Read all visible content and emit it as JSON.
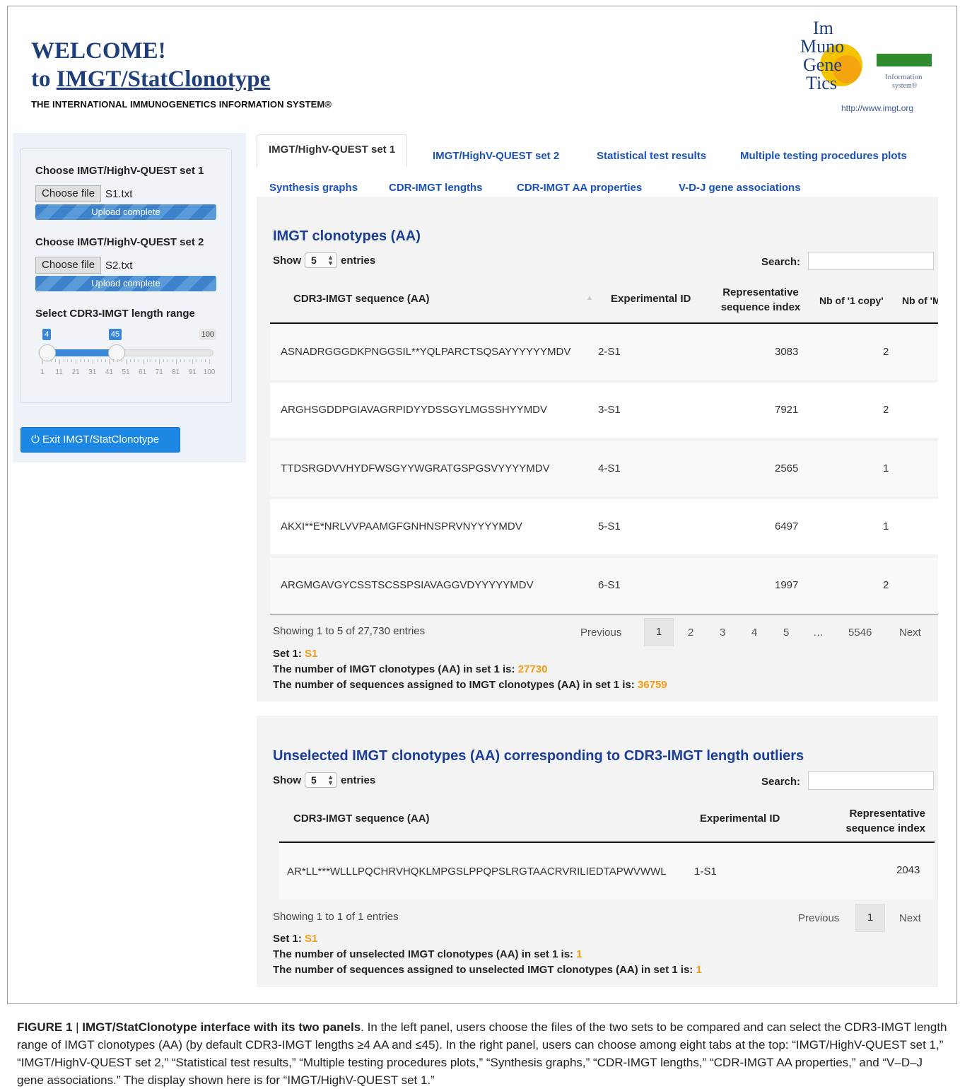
{
  "header": {
    "welcome_line1": "WELCOME!",
    "welcome_to": "to ",
    "welcome_app": "IMGT/StatClonotype",
    "subtitle": "THE INTERNATIONAL IMMUNOGENETICS INFORMATION SYSTEM®",
    "logo": {
      "letters": [
        "Im",
        "Muno",
        "Gene",
        "Tics"
      ],
      "tagline1": "Information",
      "tagline2": "system®",
      "url": "http://www.imgt.org"
    }
  },
  "sidebar": {
    "set1_label": "Choose IMGT/HighV-QUEST set 1",
    "set1_button": "Choose file",
    "set1_file": "S1.txt",
    "set1_status": "Upload complete",
    "set2_label": "Choose IMGT/HighV-QUEST set 2",
    "set2_button": "Choose file",
    "set2_file": "S2.txt",
    "set2_status": "Upload complete",
    "range_label": "Select CDR3-IMGT length range",
    "range_min": "4",
    "range_max": "45",
    "range_limit": "100",
    "range_min_value": 4,
    "range_max_value": 45,
    "range_scale_max": 100,
    "tick_labels": [
      "1",
      "11",
      "21",
      "31",
      "41",
      "51",
      "61",
      "71",
      "81",
      "91",
      "100"
    ],
    "exit_label": "Exit IMGT/StatClonotype"
  },
  "tabs": [
    "IMGT/HighV-QUEST set 1",
    "IMGT/HighV-QUEST set 2",
    "Statistical test results",
    "Multiple testing procedures plots",
    "Synthesis graphs",
    "CDR-IMGT lengths",
    "CDR-IMGT AA properties",
    "V-D-J gene associations"
  ],
  "panel1": {
    "title": "IMGT clonotypes (AA)",
    "show": "Show",
    "show_value": "5",
    "entries": "entries",
    "search_label": "Search:",
    "columns": [
      "CDR3-IMGT sequence (AA)",
      "Experimental ID",
      "Representative",
      "sequence index",
      "Nb of '1 copy'",
      "Nb of 'M"
    ],
    "rows": [
      [
        "ASNADRGGGDKPNGGSIL**YQLPARCTSQSAYYYYYYMDV",
        "2-S1",
        "3083",
        "2"
      ],
      [
        "ARGHSGDDPGIAVAGRPIDYYDSSGYLMGSSHYYMDV",
        "3-S1",
        "7921",
        "2"
      ],
      [
        "TTDSRGDVVHYDFWSGYYWGRATGSPGSVYYYYMDV",
        "4-S1",
        "2565",
        "1"
      ],
      [
        "AKXI**E*NRLVVPAAMGFGNHNSPRVNYYYYMDV",
        "5-S1",
        "6497",
        "1"
      ],
      [
        "ARGMGAVGYCSSTSCSSPSIAVAGGVDYYYYYMDV",
        "6-S1",
        "1997",
        "2"
      ]
    ],
    "showing": "Showing 1 to 5 of 27,730 entries",
    "pager": [
      "Previous",
      "1",
      "2",
      "3",
      "4",
      "5",
      "…",
      "5546",
      "Next"
    ],
    "set_label": "Set 1: ",
    "set_value": "S1",
    "count_label": "The number of IMGT clonotypes (AA) in set 1 is: ",
    "count_value": "27730",
    "seq_label": "The number of sequences assigned to IMGT clonotypes (AA) in set 1 is: ",
    "seq_value": "36759"
  },
  "panel2": {
    "title": "Unselected IMGT clonotypes (AA) corresponding to CDR3-IMGT length outliers",
    "show": "Show",
    "show_value": "5",
    "entries": "entries",
    "search_label": "Search:",
    "columns": [
      "CDR3-IMGT sequence (AA)",
      "Experimental ID",
      "Representative",
      "sequence index"
    ],
    "rows": [
      [
        "AR*LL***WLLLPQCHRVHQKLMPGSLPPQPSLRGTAACRVRILIEDTAPWVWWL",
        "1-S1",
        "2043"
      ]
    ],
    "showing": "Showing 1 to 1 of 1 entries",
    "pager": [
      "Previous",
      "1",
      "Next"
    ],
    "set_label": "Set 1: ",
    "set_value": "S1",
    "count_label": "The number of unselected IMGT clonotypes (AA) in set 1 is: ",
    "count_value": "1",
    "seq_label": "The number of sequences assigned to unselected IMGT clonotypes (AA) in set 1 is: ",
    "seq_value": "1"
  },
  "caption": {
    "label": "FIGURE 1",
    "sep": " | ",
    "title": "IMGT/StatClonotype interface with its two panels",
    "text": ". In the left panel, users choose the files of the two sets to be compared and can select the CDR3-IMGT length range of IMGT clonotypes (AA) (by default CDR3-IMGT lengths ≥4 AA and ≤45). In the right panel, users can choose among eight tabs at the top: “IMGT/HighV-QUEST set 1,” “IMGT/HighV-QUEST set 2,” “Statistical test results,” “Multiple testing procedures plots,” “Synthesis graphs,” “CDR-IMGT lengths,” “CDR-IMGT AA properties,” and “V–D–J gene associations.” The display shown here is for “IMGT/HighV-QUEST set 1.”"
  },
  "colors": {
    "title_blue": "#1f3f7a",
    "tab_blue": "#1a52b8",
    "button_blue": "#1d87e4",
    "highlight_orange": "#f59a12",
    "logo_green": "#2e8b2e",
    "logo_yellow": "#f5c400"
  },
  "icons": {
    "exit": "power-icon",
    "sort": "sort-icon",
    "select": "select-arrows-icon"
  }
}
